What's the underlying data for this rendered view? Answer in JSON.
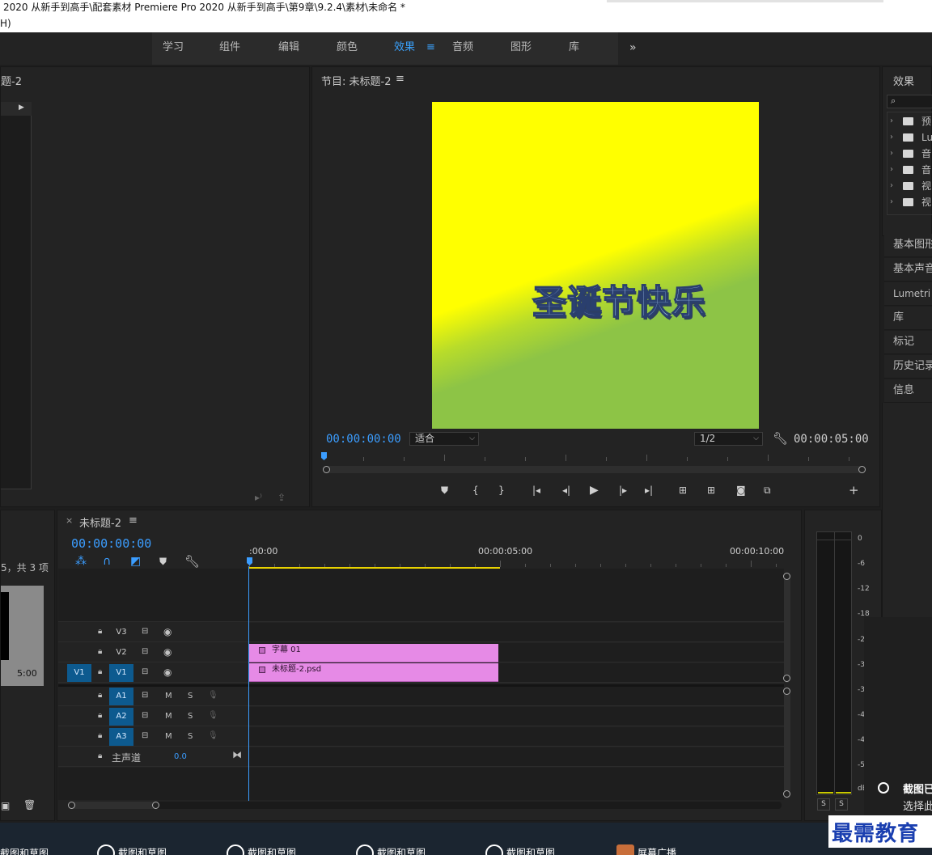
{
  "window": {
    "title": "2020 从新手到高手\\配套素材 Premiere Pro 2020 从新手到高手\\第9章\\9.2.4\\素材\\未命名 *",
    "menu_fragment": "H)"
  },
  "workspaces": {
    "tabs": [
      "学习",
      "组件",
      "编辑",
      "颜色",
      "效果",
      "音频",
      "图形",
      "库"
    ],
    "active": "效果",
    "active_menu_icon": "≡",
    "more": "»"
  },
  "source_panel": {
    "title_fragment": "题-2"
  },
  "program_monitor": {
    "title": "节目: 未标题-2",
    "menu": "≡",
    "frame_text": "圣诞节快乐",
    "timecode_current": "00:00:00:00",
    "fit_select": "适合",
    "resolution_select": "1/2",
    "timecode_duration": "00:00:05:00",
    "frame_colors": {
      "yellow": "#ffff00",
      "green": "#8dc446"
    }
  },
  "effects_panel": {
    "title": "效果",
    "search_icon": "⌕",
    "tree_items": [
      "预",
      "Lum",
      "音",
      "音",
      "视",
      "视"
    ]
  },
  "side_panels": [
    "基本图形",
    "基本声音",
    "Lumetri 颜",
    "库",
    "标记",
    "历史记录",
    "信息"
  ],
  "project_panel": {
    "count_text": "5，共 3 项",
    "thumb_duration": "5:00"
  },
  "timeline": {
    "tab_close": "×",
    "title": "未标题-2",
    "menu": "≡",
    "timecode": "00:00:00:00",
    "ruler_labels": [
      ":00:00",
      "00:00:05:00",
      "00:00:10:00"
    ],
    "video_tracks": [
      {
        "name": "V3",
        "source": ""
      },
      {
        "name": "V2",
        "source": ""
      },
      {
        "name": "V1",
        "source": "V1"
      }
    ],
    "audio_tracks": [
      {
        "name": "A1",
        "m": "M",
        "s": "S"
      },
      {
        "name": "A2",
        "m": "M",
        "s": "S"
      },
      {
        "name": "A3",
        "m": "M",
        "s": "S"
      }
    ],
    "master": {
      "label": "主声道",
      "value": "0.0"
    },
    "clips": [
      {
        "track": "V2",
        "label": "字幕 01"
      },
      {
        "track": "V1",
        "label": "未标题-2.psd"
      }
    ]
  },
  "audio_meter": {
    "labels": [
      "0",
      "-6",
      "-12",
      "-18",
      "-2",
      "-3",
      "-3",
      "-4",
      "-4",
      "-5",
      "dB"
    ],
    "solo": [
      "S",
      "S"
    ]
  },
  "notification": {
    "title": "截图已",
    "subtitle": "选择此"
  },
  "watermark": "最需教育",
  "taskbar": {
    "items": [
      "截图和草图",
      "截图和草图",
      "截图和草图",
      "截图和草图",
      "截图和草图",
      "屏幕广播"
    ]
  }
}
